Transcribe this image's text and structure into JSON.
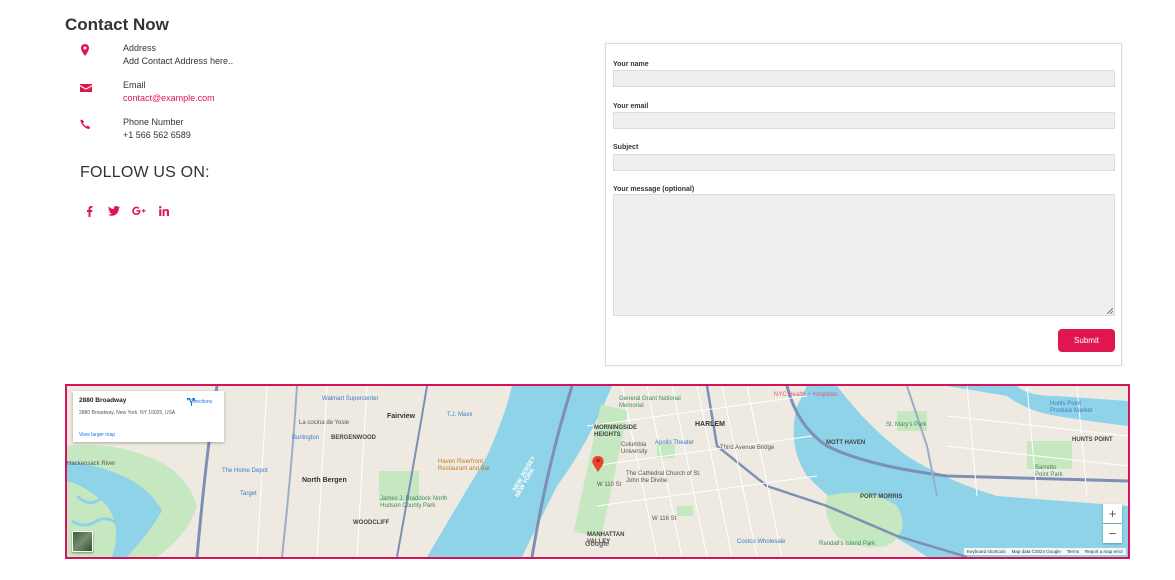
{
  "contact": {
    "title": "Contact Now",
    "items": [
      {
        "icon": "map-marker-icon",
        "label": "Address",
        "value": "Add Contact Address here.."
      },
      {
        "icon": "envelope-icon",
        "label": "Email",
        "value": "contact@example.com"
      },
      {
        "icon": "phone-icon",
        "label": "Phone Number",
        "value": "+1 566 562 6589"
      }
    ],
    "follow_title": "FOLLOW US ON:",
    "socials": [
      "facebook-icon",
      "twitter-icon",
      "google-plus-icon",
      "linkedin-icon"
    ],
    "accent_color": "#e0174f"
  },
  "form": {
    "name_label": "Your name",
    "email_label": "Your email",
    "subject_label": "Subject",
    "message_label": "Your message (optional)",
    "name_value": "",
    "email_value": "",
    "subject_value": "",
    "message_value": "",
    "submit_label": "Submit"
  },
  "map": {
    "card": {
      "title": "2880 Broadway",
      "address": "2880 Broadway, New York, NY 10025, USA",
      "directions_label": "Directions",
      "larger_map_label": "View larger map"
    },
    "labels": {
      "walmart": "Walmart Supercenter",
      "fairview": "Fairview",
      "tj_maxx": "T.J. Maxx",
      "la_cocina": "La cocina de Yosie",
      "burlington": "Burlington",
      "bergenwood": "BERGENWOOD",
      "home_depot": "The Home Depot",
      "target": "Target",
      "north_bergen": "North Bergen",
      "haven": "Haven Riverfront Restaurant and Bar",
      "braddock": "James J. Braddock North Hudson County Park",
      "woodcliff": "WOODCLIFF",
      "new_jersey": "NEW JERSEY",
      "new_york": "NEW YORK",
      "general_grant": "General Grant National Memorial",
      "morningside": "MORNINGSIDE HEIGHTS",
      "columbia": "Columbia University",
      "apollo": "Apollo Theater",
      "harlem": "HARLEM",
      "cathedral": "The Cathedral Church of St. John the Divine",
      "third_ave": "Third Avenue Bridge",
      "manhattan_valley": "MANHATTAN VALLEY",
      "costco": "Costco Wholesale",
      "randalls": "Randall's Island Park",
      "nyc_health": "NYC Health + Hospitals",
      "mott_haven": "MOTT HAVEN",
      "st_marys": "St. Mary's Park",
      "port_morris": "PORT MORRIS",
      "hunts_point_market": "Hunts Point Produce Market",
      "hunts_point": "HUNTS POINT",
      "barretto": "Barretto Point Park",
      "hackensack": "Hackensack River",
      "w_110": "W 110 St",
      "w_116": "W 116 St"
    },
    "zoom_in": "+",
    "zoom_out": "−",
    "logo": "Google",
    "footer": [
      "Keyboard shortcuts",
      "Map data ©2024 Google",
      "Terms",
      "Report a map error"
    ],
    "water_color": "#8fd3e8",
    "park_color": "#c6e8c0",
    "land_color": "#eeeae2",
    "highway_color": "#7d8fb5"
  }
}
